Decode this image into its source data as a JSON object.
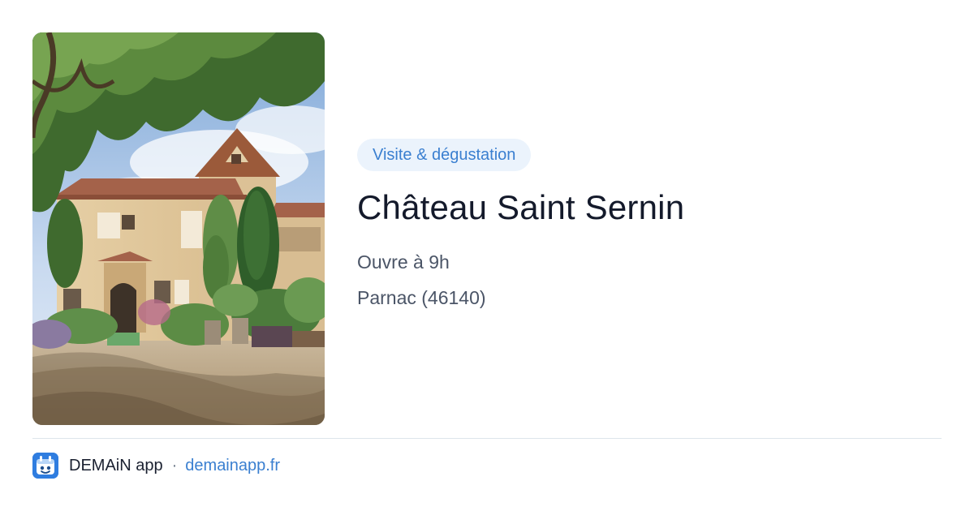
{
  "card": {
    "category_tag": "Visite & dégustation",
    "title": "Château Saint Sernin",
    "opening": "Ouvre à 9h",
    "location": "Parnac (46140)"
  },
  "footer": {
    "app_name": "DEMAiN app",
    "separator": "·",
    "site": "demainapp.fr"
  },
  "colors": {
    "tag_background": "#ebf3fc",
    "accent": "#3a7fd0",
    "title_text": "#141a2b",
    "meta_text": "#4b5567",
    "divider": "#dde5eb"
  },
  "icons": {
    "app_logo": "demain-app-icon"
  }
}
